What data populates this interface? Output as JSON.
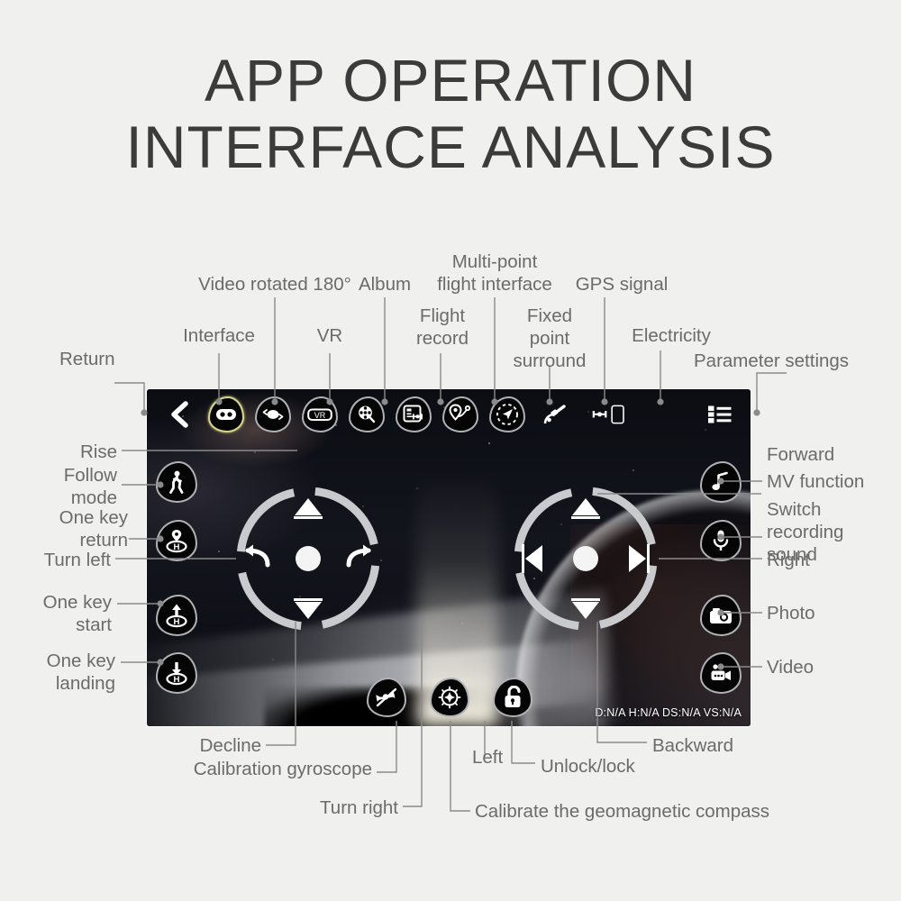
{
  "title": {
    "line1": "APP OPERATION",
    "line2": "INTERFACE ANALYSIS"
  },
  "screen": {
    "telemetry": "D:N/A H:N/A DS:N/A VS:N/A",
    "accent_highlight": "#d6d68a",
    "background_color": "#050608"
  },
  "topbar": {
    "items": [
      {
        "icon": "back-chevron-icon",
        "label": "Return"
      },
      {
        "icon": "gamepad-icon",
        "label": "Interface",
        "highlighted": true
      },
      {
        "icon": "video-rotate-180-icon",
        "label": "Video rotated 180°"
      },
      {
        "icon": "vr-goggles-icon",
        "label": "VR"
      },
      {
        "icon": "album-film-icon",
        "label": "Album"
      },
      {
        "icon": "flight-record-icon",
        "label": "Flight record"
      },
      {
        "icon": "multi-point-route-icon",
        "label": "Multi-point flight interface"
      },
      {
        "icon": "fixed-point-surround-icon",
        "label": "Fixed point surround"
      },
      {
        "icon": "gps-satellite-icon",
        "label": "GPS signal"
      },
      {
        "icon": "battery-electricity-icon",
        "label": "Electricity"
      },
      {
        "icon": "settings-list-icon",
        "label": "Parameter settings"
      }
    ]
  },
  "left_buttons": [
    {
      "icon": "follow-me-walking-icon",
      "label": "Follow mode"
    },
    {
      "icon": "one-key-return-home-icon",
      "label": "One key return"
    },
    {
      "icon": "one-key-start-takeoff-icon",
      "label": "One key start"
    },
    {
      "icon": "one-key-landing-icon",
      "label": "One key landing"
    }
  ],
  "right_buttons": [
    {
      "icon": "music-note-icon",
      "label": "MV function"
    },
    {
      "icon": "microphone-icon",
      "label": "Switch recording sound"
    },
    {
      "icon": "camera-photo-icon",
      "label": "Photo"
    },
    {
      "icon": "video-camera-icon",
      "label": "Video"
    }
  ],
  "bottom_buttons": [
    {
      "icon": "gyroscope-calibration-icon",
      "label": "Calibration gyroscope"
    },
    {
      "icon": "compass-icon",
      "label": "Calibrate the geomagnetic compass"
    },
    {
      "icon": "unlock-padlock-icon",
      "label": "Unlock/lock"
    }
  ],
  "left_stick": {
    "up": "Rise",
    "down": "Decline",
    "left": "Turn left",
    "right": "Turn right"
  },
  "right_stick": {
    "up": "Forward",
    "down": "Backward",
    "left": "Left",
    "right": "Right"
  },
  "callouts": {
    "return": "Return",
    "interface": "Interface",
    "video_rotated": "Video rotated 180°",
    "vr": "VR",
    "album": "Album",
    "flight_record_l1": "Flight",
    "flight_record_l2": "record",
    "multipoint_l1": "Multi-point",
    "multipoint_l2": "flight interface",
    "fixed_point_l1": "Fixed",
    "fixed_point_l2": "point",
    "fixed_point_l3": "surround",
    "gps_signal": "GPS signal",
    "electricity": "Electricity",
    "parameter_settings": "Parameter settings",
    "rise": "Rise",
    "follow_mode_l1": "Follow",
    "follow_mode_l2": "mode",
    "one_key_return_l1": "One key",
    "one_key_return_l2": "return",
    "turn_left": "Turn left",
    "one_key_start_l1": "One key",
    "one_key_start_l2": "start",
    "one_key_landing_l1": "One key",
    "one_key_landing_l2": "landing",
    "forward": "Forward",
    "mv_function": "MV function",
    "switch_recording_l1": "Switch",
    "switch_recording_l2": "recording",
    "switch_recording_l3": "sound",
    "right": "Right",
    "photo": "Photo",
    "video": "Video",
    "decline": "Decline",
    "calibration_gyroscope": "Calibration gyroscope",
    "turn_right": "Turn right",
    "left": "Left",
    "calibrate_compass": "Calibrate the geomagnetic compass",
    "unlock_lock": "Unlock/lock",
    "backward": "Backward"
  }
}
